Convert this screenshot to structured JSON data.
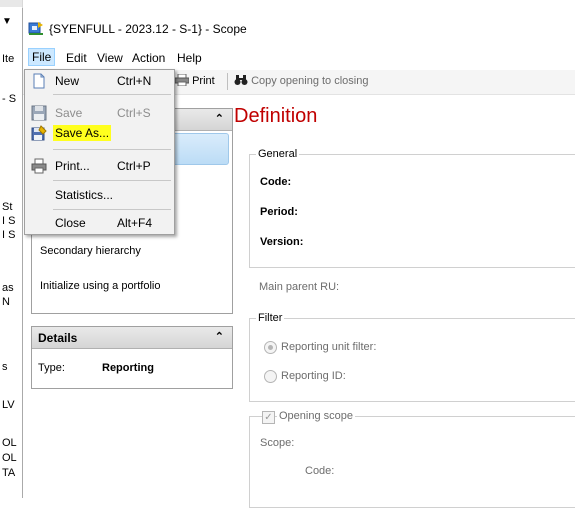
{
  "window": {
    "title": "{SYENFULL - 2023.12 - S-1} - Scope"
  },
  "background_fragments": [
    "Ite",
    "- S",
    "St",
    "I S",
    "I S",
    "as",
    "N",
    "s",
    "LV",
    "OL",
    "OL",
    "TA"
  ],
  "menubar": {
    "items": [
      "File",
      "Edit",
      "View",
      "Action",
      "Help"
    ],
    "open": "File"
  },
  "toolbar": {
    "print_label": "Print",
    "copy_label": "Copy opening to closing"
  },
  "file_menu": {
    "items": [
      {
        "label": "New",
        "shortcut": "Ctrl+N",
        "icon": "new-document-icon",
        "disabled": false
      },
      {
        "label": "Save",
        "shortcut": "Ctrl+S",
        "icon": "floppy-disk-icon",
        "disabled": true
      },
      {
        "label": "Save As...",
        "shortcut": "",
        "icon": "save-as-icon",
        "disabled": false,
        "highlighted": true
      },
      {
        "label": "Print...",
        "shortcut": "Ctrl+P",
        "icon": "printer-icon",
        "disabled": false
      },
      {
        "label": "Statistics...",
        "shortcut": "",
        "icon": "",
        "disabled": false
      },
      {
        "label": "Close",
        "shortcut": "Alt+F4",
        "icon": "",
        "disabled": false
      }
    ]
  },
  "nav": {
    "tasks_items": [
      "Secondary hierarchy",
      "Initialize using a portfolio"
    ],
    "details_title": "Details",
    "type_label": "Type:",
    "type_value": "Reporting"
  },
  "content": {
    "heading": "Definition",
    "general_group": "General",
    "code_label": "Code:",
    "period_label": "Period:",
    "version_label": "Version:",
    "main_parent_label": "Main parent RU:",
    "filter_group": "Filter",
    "radio_reporting_unit_filter": "Reporting unit filter:",
    "radio_reporting_id": "Reporting ID:",
    "opening_scope_label": "Opening scope",
    "scope_label": "Scope:",
    "scope_code_label": "Code:"
  }
}
